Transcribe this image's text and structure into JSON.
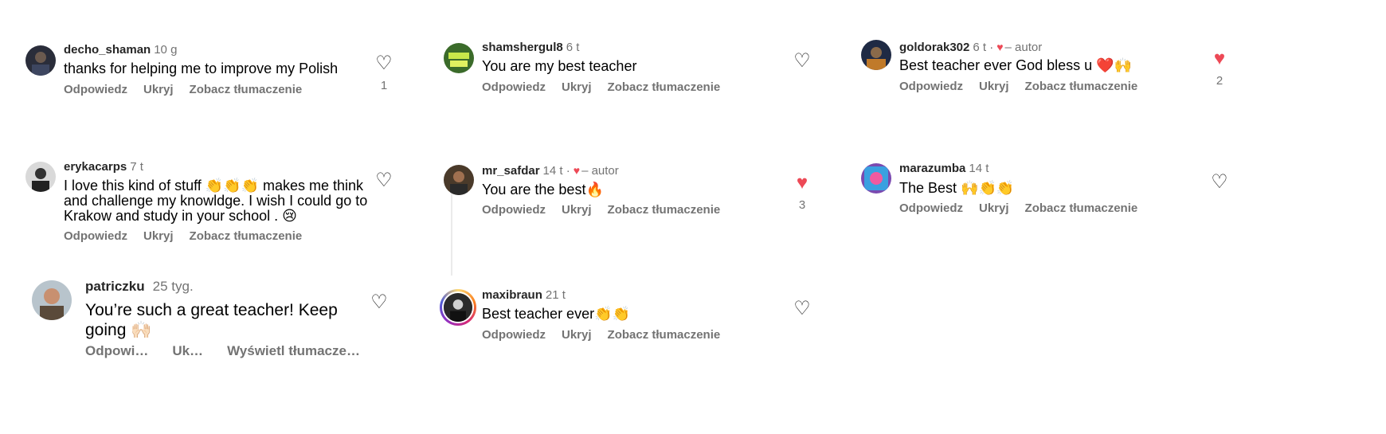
{
  "actions": {
    "reply": "Odpowiedz",
    "hide": "Ukryj",
    "translate": "Zobacz tłumaczenie"
  },
  "comments": [
    {
      "username": "decho_shaman",
      "time": "10 g",
      "text": "thanks for helping me to improve my Polish",
      "likes": "1",
      "liked": false
    },
    {
      "username": "shamshergul8",
      "time": "6 t",
      "text": "You are my best teacher",
      "liked": false
    },
    {
      "username": "goldorak302",
      "time": "6 t",
      "sep": "·",
      "author_label": "– autor",
      "text": "Best teacher ever God bless u ❤️🙌",
      "likes": "2",
      "liked": true
    },
    {
      "username": "erykacarps",
      "time": "7 t",
      "text_lines": [
        "I love this kind of stuff 👏👏👏 makes me think",
        "and challenge my knowldge. I wish I could go to",
        "Krakow and study in your school . 😢"
      ],
      "liked": false
    },
    {
      "username": "mr_safdar",
      "time": "14 t",
      "sep": "·",
      "author_label": "– autor",
      "text": "You are the best🔥",
      "likes": "3",
      "liked": true
    },
    {
      "username": "marazumba",
      "time": "14 t",
      "text": "The Best 🙌👏👏",
      "liked": false
    },
    {
      "username": "patriczku",
      "time": "25 tyg.",
      "text": "You’re such a great teacher! Keep going 🙌🏻",
      "actions": {
        "reply": "Odpowi…",
        "hide": "Uk…",
        "translate": "Wyświetl tłumacze…"
      },
      "liked": false
    },
    {
      "username": "maxibraun",
      "time": "21 t",
      "text": "Best teacher ever👏👏",
      "liked": false
    }
  ],
  "icons": {
    "heart_outline": "heart-outline-icon",
    "heart_filled": "heart-filled-icon"
  },
  "colors": {
    "like_red": "#ed4956",
    "secondary_text": "#737373"
  }
}
